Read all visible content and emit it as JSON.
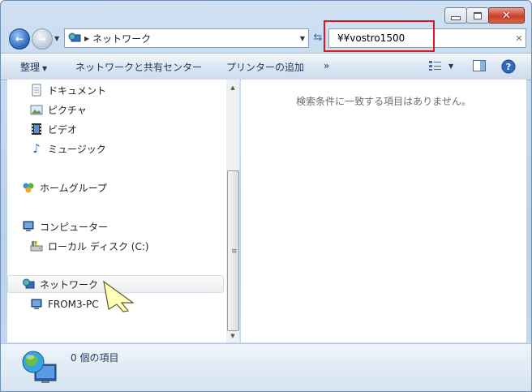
{
  "address": {
    "location": "ネットワーク"
  },
  "search": {
    "value": "¥¥vostro1500"
  },
  "toolbar": {
    "organize": "整理",
    "network_sharing": "ネットワークと共有センター",
    "add_printer": "プリンターの追加",
    "more": "»"
  },
  "nav": {
    "documents": "ドキュメント",
    "pictures": "ピクチャ",
    "videos": "ビデオ",
    "music": "ミュージック",
    "homegroup": "ホームグループ",
    "computer": "コンピューター",
    "local_disk": "ローカル ディスク (C:)",
    "network": "ネットワーク",
    "from3pc": "FROM3-PC"
  },
  "content": {
    "empty_message": "検索条件に一致する項目はありません。"
  },
  "details": {
    "status": "0 個の項目"
  },
  "colors": {
    "highlight": "#e0141b",
    "accent": "#2a63b8"
  }
}
